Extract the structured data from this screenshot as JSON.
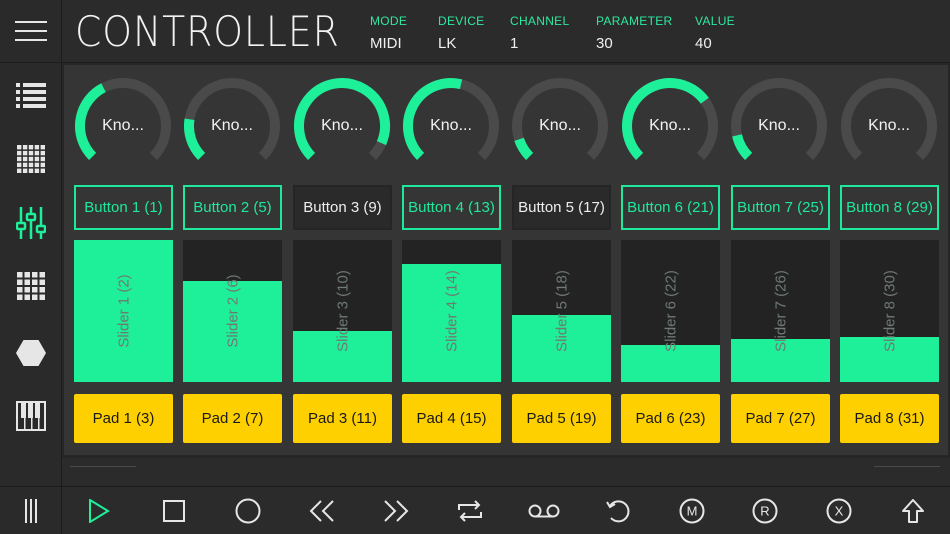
{
  "header": {
    "title": "CONTROLLER",
    "fields": [
      {
        "label": "MODE",
        "value": "MIDI"
      },
      {
        "label": "DEVICE",
        "value": "LK"
      },
      {
        "label": "CHANNEL",
        "value": "1"
      },
      {
        "label": "PARAMETER",
        "value": "30"
      },
      {
        "label": "VALUE",
        "value": "40"
      }
    ]
  },
  "sidebar": {
    "items": [
      {
        "name": "list",
        "icon": "list-icon",
        "active": false
      },
      {
        "name": "grid-small",
        "icon": "grid-small-icon",
        "active": false
      },
      {
        "name": "mixer",
        "icon": "sliders-icon",
        "active": true
      },
      {
        "name": "grid-large",
        "icon": "grid-large-icon",
        "active": false
      },
      {
        "name": "hexagon",
        "icon": "hexagon-icon",
        "active": false
      },
      {
        "name": "keyboard",
        "icon": "piano-keys-icon",
        "active": false
      }
    ]
  },
  "knobs": [
    {
      "label": "Kno...",
      "level": 0.4
    },
    {
      "label": "Kno...",
      "level": 0.2
    },
    {
      "label": "Kno...",
      "level": 0.92
    },
    {
      "label": "Kno...",
      "level": 0.55
    },
    {
      "label": "Kno...",
      "level": 0.1
    },
    {
      "label": "Kno...",
      "level": 0.7
    },
    {
      "label": "Kno...",
      "level": 0.12
    },
    {
      "label": "Kno...",
      "level": 0.0
    }
  ],
  "buttons": [
    {
      "label": "Button 1 (1)",
      "on": true
    },
    {
      "label": "Button 2 (5)",
      "on": true
    },
    {
      "label": "Button 3 (9)",
      "on": false
    },
    {
      "label": "Button 4 (13)",
      "on": true
    },
    {
      "label": "Button 5 (17)",
      "on": false
    },
    {
      "label": "Button 6 (21)",
      "on": true
    },
    {
      "label": "Button 7 (25)",
      "on": true
    },
    {
      "label": "Button 8 (29)",
      "on": true
    }
  ],
  "sliders": [
    {
      "label": "Slider 1 (2)",
      "level": 1.0
    },
    {
      "label": "Slider 2 (6)",
      "level": 0.71
    },
    {
      "label": "Slider 3 (10)",
      "level": 0.36
    },
    {
      "label": "Slider 4 (14)",
      "level": 0.83
    },
    {
      "label": "Slider 5 (18)",
      "level": 0.47
    },
    {
      "label": "Slider 6 (22)",
      "level": 0.26
    },
    {
      "label": "Slider 7 (26)",
      "level": 0.3
    },
    {
      "label": "Slider 8 (30)",
      "level": 0.32
    }
  ],
  "pads": [
    {
      "label": "Pad 1 (3)"
    },
    {
      "label": "Pad 2 (7)"
    },
    {
      "label": "Pad 3 (11)"
    },
    {
      "label": "Pad 4 (15)"
    },
    {
      "label": "Pad 5 (19)"
    },
    {
      "label": "Pad 6 (23)"
    },
    {
      "label": "Pad 7 (27)"
    },
    {
      "label": "Pad 8 (31)"
    }
  ],
  "transport": [
    {
      "name": "play",
      "icon": "play-icon"
    },
    {
      "name": "stop",
      "icon": "stop-icon"
    },
    {
      "name": "record",
      "icon": "circle-icon"
    },
    {
      "name": "rewind",
      "icon": "rewind-icon"
    },
    {
      "name": "fast-forward",
      "icon": "fast-forward-icon"
    },
    {
      "name": "loop",
      "icon": "loop-icon"
    },
    {
      "name": "tape",
      "icon": "tape-icon"
    },
    {
      "name": "undo",
      "icon": "undo-icon"
    },
    {
      "name": "mute",
      "icon": "m-circle-icon",
      "letter": "M"
    },
    {
      "name": "read",
      "icon": "r-circle-icon",
      "letter": "R"
    },
    {
      "name": "close",
      "icon": "x-circle-icon",
      "letter": "X"
    },
    {
      "name": "shift",
      "icon": "shift-up-icon"
    }
  ],
  "colors": {
    "accent": "#1ef09a",
    "pad": "#ffd000",
    "knob_track": "#4a4a4a"
  }
}
